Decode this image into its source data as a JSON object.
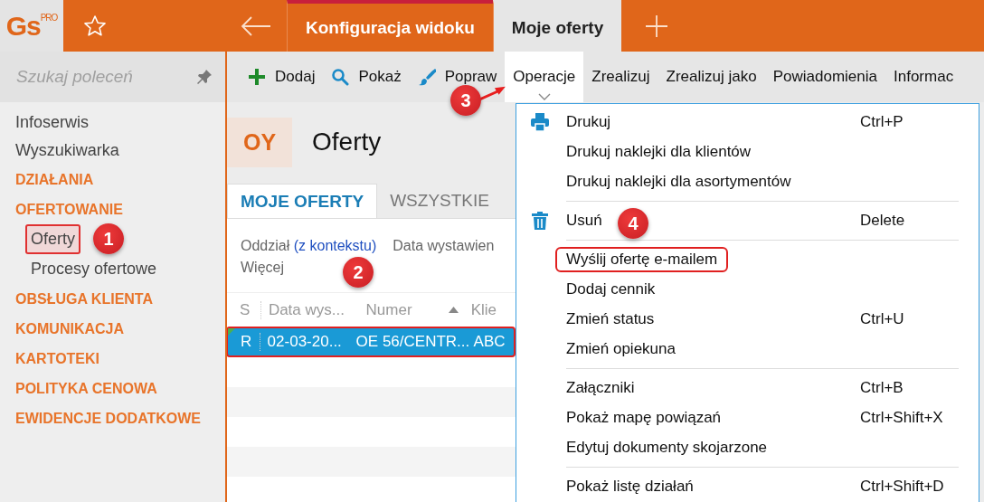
{
  "logo": {
    "text": "Gs",
    "superscript": "PRO"
  },
  "tabs": [
    {
      "label": "Konfiguracja widoku",
      "selected": false
    },
    {
      "label": "Moje oferty",
      "selected": true
    }
  ],
  "command_search": {
    "placeholder": "Szukaj poleceń"
  },
  "toolbar": [
    {
      "label": "Dodaj",
      "kind": "add",
      "selected": false
    },
    {
      "label": "Pokaż",
      "kind": "view",
      "selected": false
    },
    {
      "label": "Popraw",
      "kind": "edit",
      "selected": false
    },
    {
      "label": "Operacje",
      "kind": "dropdown",
      "selected": true
    },
    {
      "label": "Zrealizuj",
      "kind": "plain",
      "selected": false
    },
    {
      "label": "Zrealizuj jako",
      "kind": "plain",
      "selected": false
    },
    {
      "label": "Powiadomienia",
      "kind": "plain",
      "selected": false
    },
    {
      "label": "Informac",
      "kind": "plain",
      "selected": false
    }
  ],
  "sidebar": {
    "items": [
      {
        "label": "Infoserwis",
        "kind": "link"
      },
      {
        "label": "Wyszukiwarka",
        "kind": "link"
      },
      {
        "label": "DZIAŁANIA",
        "kind": "section"
      },
      {
        "label": "OFERTOWANIE",
        "kind": "section",
        "children": [
          {
            "label": "Oferty",
            "selected": true
          },
          {
            "label": "Procesy ofertowe",
            "selected": false
          }
        ]
      },
      {
        "label": "OBSŁUGA KLIENTA",
        "kind": "section"
      },
      {
        "label": "KOMUNIKACJA",
        "kind": "section"
      },
      {
        "label": "KARTOTEKI",
        "kind": "section"
      },
      {
        "label": "POLITYKA CENOWA",
        "kind": "section"
      },
      {
        "label": "EWIDENCJE DODATKOWE",
        "kind": "section"
      }
    ]
  },
  "view": {
    "code": "OY",
    "title": "Oferty",
    "tabs": [
      {
        "label": "MOJE OFERTY",
        "selected": true
      },
      {
        "label": "WSZYSTKIE",
        "selected": false
      }
    ],
    "filters": [
      {
        "label": "Oddział",
        "value": "(z kontekstu)"
      },
      {
        "label": "Data wystawien"
      }
    ],
    "more": "Więcej",
    "table": {
      "columns": [
        {
          "label": "S",
          "sorted": false
        },
        {
          "label": "Data wys...",
          "sorted": false
        },
        {
          "label": "Numer",
          "sorted": true
        },
        {
          "label": "Klie",
          "sorted": false
        }
      ],
      "rows": [
        {
          "cells": [
            "R",
            "02-03-20...",
            "OE 56/CENTR...",
            "ABC"
          ],
          "selected": true,
          "highlighted": true
        }
      ]
    }
  },
  "menu": {
    "groups": [
      {
        "items": [
          {
            "label": "Drukuj",
            "shortcut": "Ctrl+P",
            "kind": "print",
            "highlighted": false
          },
          {
            "label": "Drukuj naklejki dla klientów",
            "kind": "plain",
            "highlighted": false
          },
          {
            "label": "Drukuj naklejki dla asortymentów",
            "kind": "plain",
            "highlighted": false
          }
        ]
      },
      {
        "items": [
          {
            "label": "Usuń",
            "shortcut": "Delete",
            "kind": "delete",
            "highlighted": false
          }
        ]
      },
      {
        "items": [
          {
            "label": "Wyślij ofertę e-mailem",
            "highlighted": true
          },
          {
            "label": "Dodaj cennik",
            "highlighted": false
          },
          {
            "label": "Zmień status",
            "shortcut": "Ctrl+U",
            "highlighted": false
          },
          {
            "label": "Zmień opiekuna",
            "highlighted": false
          }
        ]
      },
      {
        "items": [
          {
            "label": "Załączniki",
            "shortcut": "Ctrl+B",
            "highlighted": false
          },
          {
            "label": "Pokaż mapę powiązań",
            "shortcut": "Ctrl+Shift+X",
            "highlighted": false
          },
          {
            "label": "Edytuj dokumenty skojarzone",
            "highlighted": false
          }
        ]
      },
      {
        "items": [
          {
            "label": "Pokaż listę działań",
            "shortcut": "Ctrl+Shift+D",
            "highlighted": false
          }
        ]
      }
    ]
  },
  "annotations": [
    {
      "number": "1",
      "arrow": false
    },
    {
      "number": "2",
      "arrow": false
    },
    {
      "number": "3",
      "arrow": true
    },
    {
      "number": "4",
      "arrow": false
    }
  ]
}
